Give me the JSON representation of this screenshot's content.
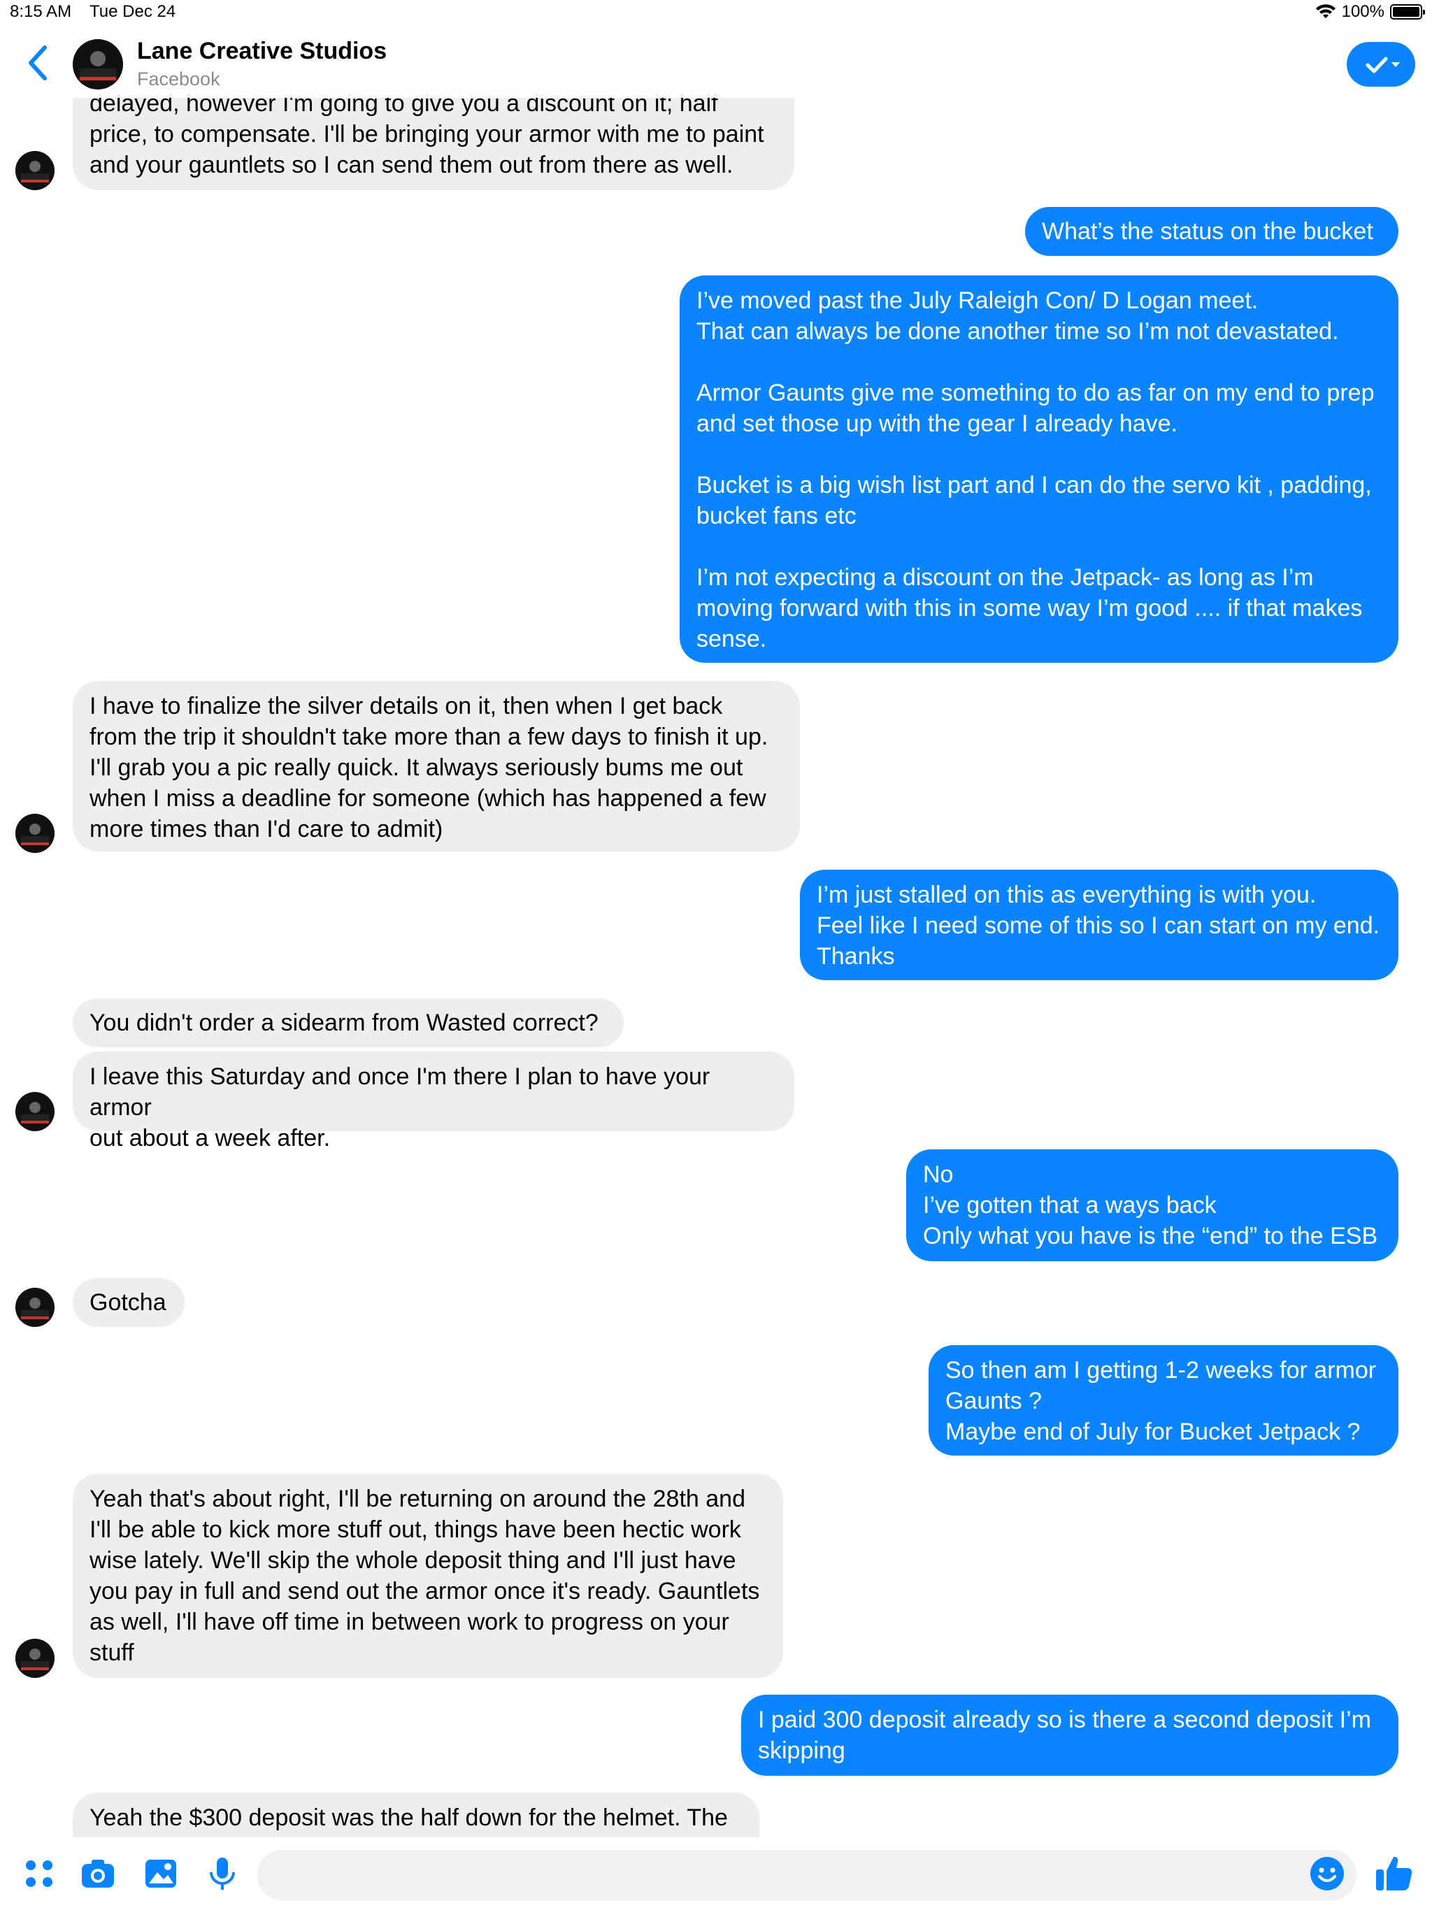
{
  "status_bar": {
    "time": "8:15 AM",
    "date": "Tue Dec 24",
    "battery": "100%"
  },
  "header": {
    "contact_name": "Lane Creative Studios",
    "contact_source": "Facebook"
  },
  "messages": [
    {
      "from": "them",
      "text": "delayed, however I'm going to give you a discount on it; half\nprice, to compensate. I'll be bringing your armor with me to paint\nand your gauntlets so I can send them out from there as well."
    },
    {
      "from": "me",
      "text": "What’s the status on the bucket"
    },
    {
      "from": "me",
      "text": "I’ve moved past the July Raleigh Con/ D Logan meet.\nThat can always be done another time so I’m not devastated.\n\nArmor Gaunts give me something to do as far on my end to prep\nand set those up with the gear I already have.\n\nBucket is a big wish list part and I can do the servo kit , padding,\nbucket fans etc\n\nI’m not expecting a discount on the Jetpack- as long as I’m\nmoving forward with this in some way I’m good .... if that makes\nsense."
    },
    {
      "from": "them",
      "text": "I have to finalize the silver details on it, then when I get back\nfrom the trip it shouldn't take more than a few days to finish it up.\nI'll grab you a pic really quick. It always seriously bums me out\nwhen I miss a deadline for someone (which has happened a few\nmore times than I'd care to admit)"
    },
    {
      "from": "me",
      "text": "I’m just stalled on this as everything is with you.\nFeel like I need some of this so I can start on my end.\nThanks"
    },
    {
      "from": "them",
      "text": "You didn't order a sidearm from Wasted correct?"
    },
    {
      "from": "them",
      "text": "I leave this Saturday and once I'm there I plan to have your armor\nout about a week after."
    },
    {
      "from": "me",
      "text": "No\nI’ve gotten that a ways back\nOnly what you have is the “end” to the ESB"
    },
    {
      "from": "them",
      "text": "Gotcha"
    },
    {
      "from": "me",
      "text": "So then am I getting 1-2 weeks for armor\nGaunts ?\nMaybe end of July for Bucket Jetpack ?"
    },
    {
      "from": "them",
      "text": "Yeah that's about right, I'll be returning on around the 28th and\nI'll be able to kick more stuff out, things have been hectic work\nwise lately. We'll skip the whole deposit thing and I'll just have\nyou pay in full and send out the armor once it's ready. Gauntlets\nas well, I'll have off time in between work to progress on your\nstuff"
    },
    {
      "from": "me",
      "text": "I paid 300 deposit already so is there a second deposit I’m\nskipping"
    },
    {
      "from": "them",
      "text": "Yeah the $300 deposit was the half down for the helmet. The"
    }
  ],
  "composer": {
    "placeholder": ""
  },
  "colors": {
    "accent": "#0a84ff",
    "incoming_bubble": "#eeeeee"
  }
}
